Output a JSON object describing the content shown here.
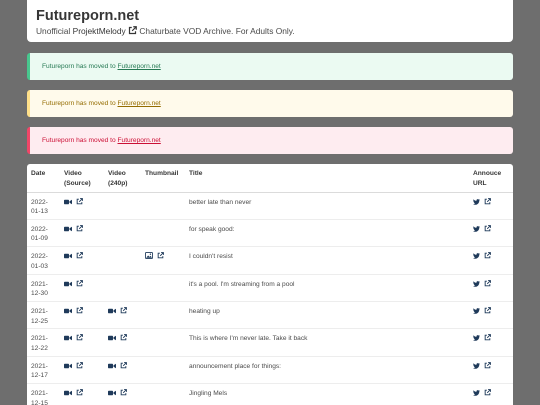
{
  "site": {
    "title": "Futureporn.net",
    "tagline_prefix": "Unofficial",
    "tagline_link": "ProjektMelody",
    "tagline_suffix": "Chaturbate VOD Archive. For Adults Only."
  },
  "notices": [
    {
      "text": "Futureporn has moved to",
      "link": "Futureporn.net"
    },
    {
      "text": "Futureporn has moved to",
      "link": "Futureporn.net"
    },
    {
      "text": "Futureporn has moved to",
      "link": "Futureporn.net"
    }
  ],
  "table": {
    "headers": {
      "date": "Date",
      "video_source": "Video (Source)",
      "video_240p": "Video (240p)",
      "thumbnail": "Thumbnail",
      "title": "Title",
      "announce": "Annouce URL"
    },
    "rows": [
      {
        "date": "2022-01-13",
        "title": "better late than never",
        "has_240p": false,
        "has_thumb": false
      },
      {
        "date": "2022-01-09",
        "title": "for speak good:",
        "has_240p": false,
        "has_thumb": false
      },
      {
        "date": "2022-01-03",
        "title": "I couldn't resist",
        "has_240p": false,
        "has_thumb": true
      },
      {
        "date": "2021-12-30",
        "title": "it's a pool. I'm streaming from a pool",
        "has_240p": false,
        "has_thumb": false
      },
      {
        "date": "2021-12-25",
        "title": "heating up",
        "has_240p": true,
        "has_thumb": false
      },
      {
        "date": "2021-12-22",
        "title": "This is where I'm never late. Take it back",
        "has_240p": true,
        "has_thumb": false
      },
      {
        "date": "2021-12-17",
        "title": "announcement place for things:",
        "has_240p": true,
        "has_thumb": false
      },
      {
        "date": "2021-12-15",
        "title": "Jingling Mels",
        "has_240p": true,
        "has_thumb": false
      }
    ]
  },
  "icons": {
    "video": "video-camera-icon",
    "external": "external-link-icon",
    "image": "image-icon",
    "twitter": "twitter-icon"
  },
  "colors": {
    "background": "#6e6e6e",
    "link": "#363636",
    "success": "#48c78e",
    "warning": "#ffe08a",
    "danger": "#f14668",
    "icon": "#1f3a5a"
  }
}
